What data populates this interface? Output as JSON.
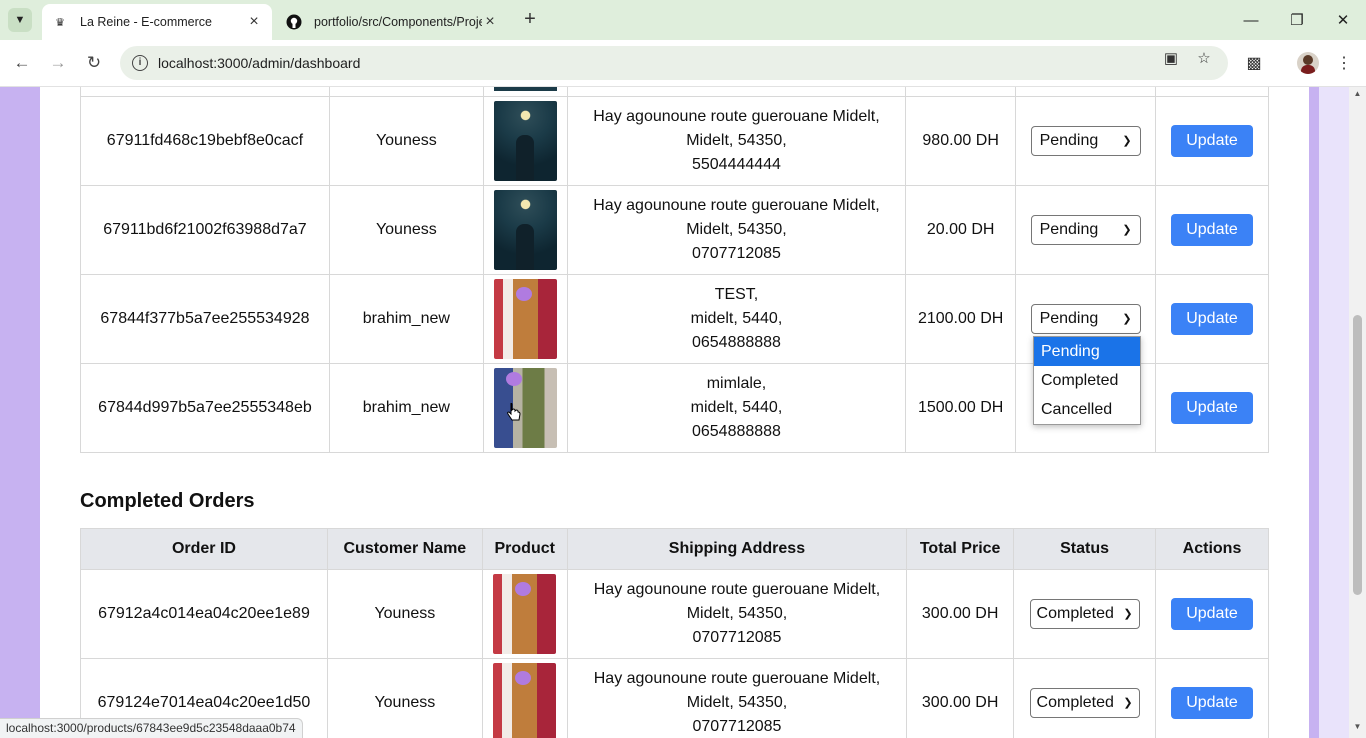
{
  "browser": {
    "tabs": [
      {
        "title": "La Reine - E-commerce",
        "active": true
      },
      {
        "title": "portfolio/src/Components/Proje",
        "active": false
      }
    ],
    "url": "localhost:3000/admin/dashboard",
    "status_url": "localhost:3000/products/67843ee9d5c23548daaa0b74"
  },
  "pending_orders": [
    {
      "id": "67911fd468c19bebf8e0cacf",
      "customer": "Youness",
      "image": "night",
      "address": [
        "Hay agounoune route guerouane Midelt,",
        "Midelt, 54350,",
        "5504444444"
      ],
      "total": "980.00 DH",
      "status": "Pending",
      "action": "Update"
    },
    {
      "id": "67911bd6f21002f63988d7a7",
      "customer": "Youness",
      "image": "night",
      "address": [
        "Hay agounoune route guerouane Midelt,",
        "Midelt, 54350,",
        "0707712085"
      ],
      "total": "20.00 DH",
      "status": "Pending",
      "action": "Update"
    },
    {
      "id": "67844f377b5a7ee255534928",
      "customer": "brahim_new",
      "image": "dress",
      "address": [
        "TEST,",
        "midelt, 5440,",
        "0654888888"
      ],
      "total": "2100.00 DH",
      "status": "Pending",
      "action": "Update"
    },
    {
      "id": "67844d997b5a7ee2555348eb",
      "customer": "brahim_new",
      "image": "green",
      "address": [
        "mimlale,",
        "midelt, 5440,",
        "0654888888"
      ],
      "total": "1500.00 DH",
      "status": "",
      "action": "Update"
    }
  ],
  "status_dropdown": {
    "options": [
      "Pending",
      "Completed",
      "Cancelled"
    ],
    "selected": "Pending"
  },
  "completed_section": {
    "title": "Completed Orders",
    "headers": [
      "Order ID",
      "Customer Name",
      "Product",
      "Shipping Address",
      "Total Price",
      "Status",
      "Actions"
    ],
    "orders": [
      {
        "id": "67912a4c014ea04c20ee1e89",
        "customer": "Youness",
        "image": "dress",
        "address": [
          "Hay agounoune route guerouane Midelt,",
          "Midelt, 54350,",
          "0707712085"
        ],
        "total": "300.00 DH",
        "status": "Completed",
        "action": "Update"
      },
      {
        "id": "679124e7014ea04c20ee1d50",
        "customer": "Youness",
        "image": "dress",
        "address": [
          "Hay agounoune route guerouane Midelt,",
          "Midelt, 54350,",
          "0707712085"
        ],
        "total": "300.00 DH",
        "status": "Completed",
        "action": "Update"
      }
    ]
  },
  "colors": {
    "accent": "#3b82f6",
    "page_bg": "#c7b2f1",
    "tabbar": "#dfeedc"
  }
}
